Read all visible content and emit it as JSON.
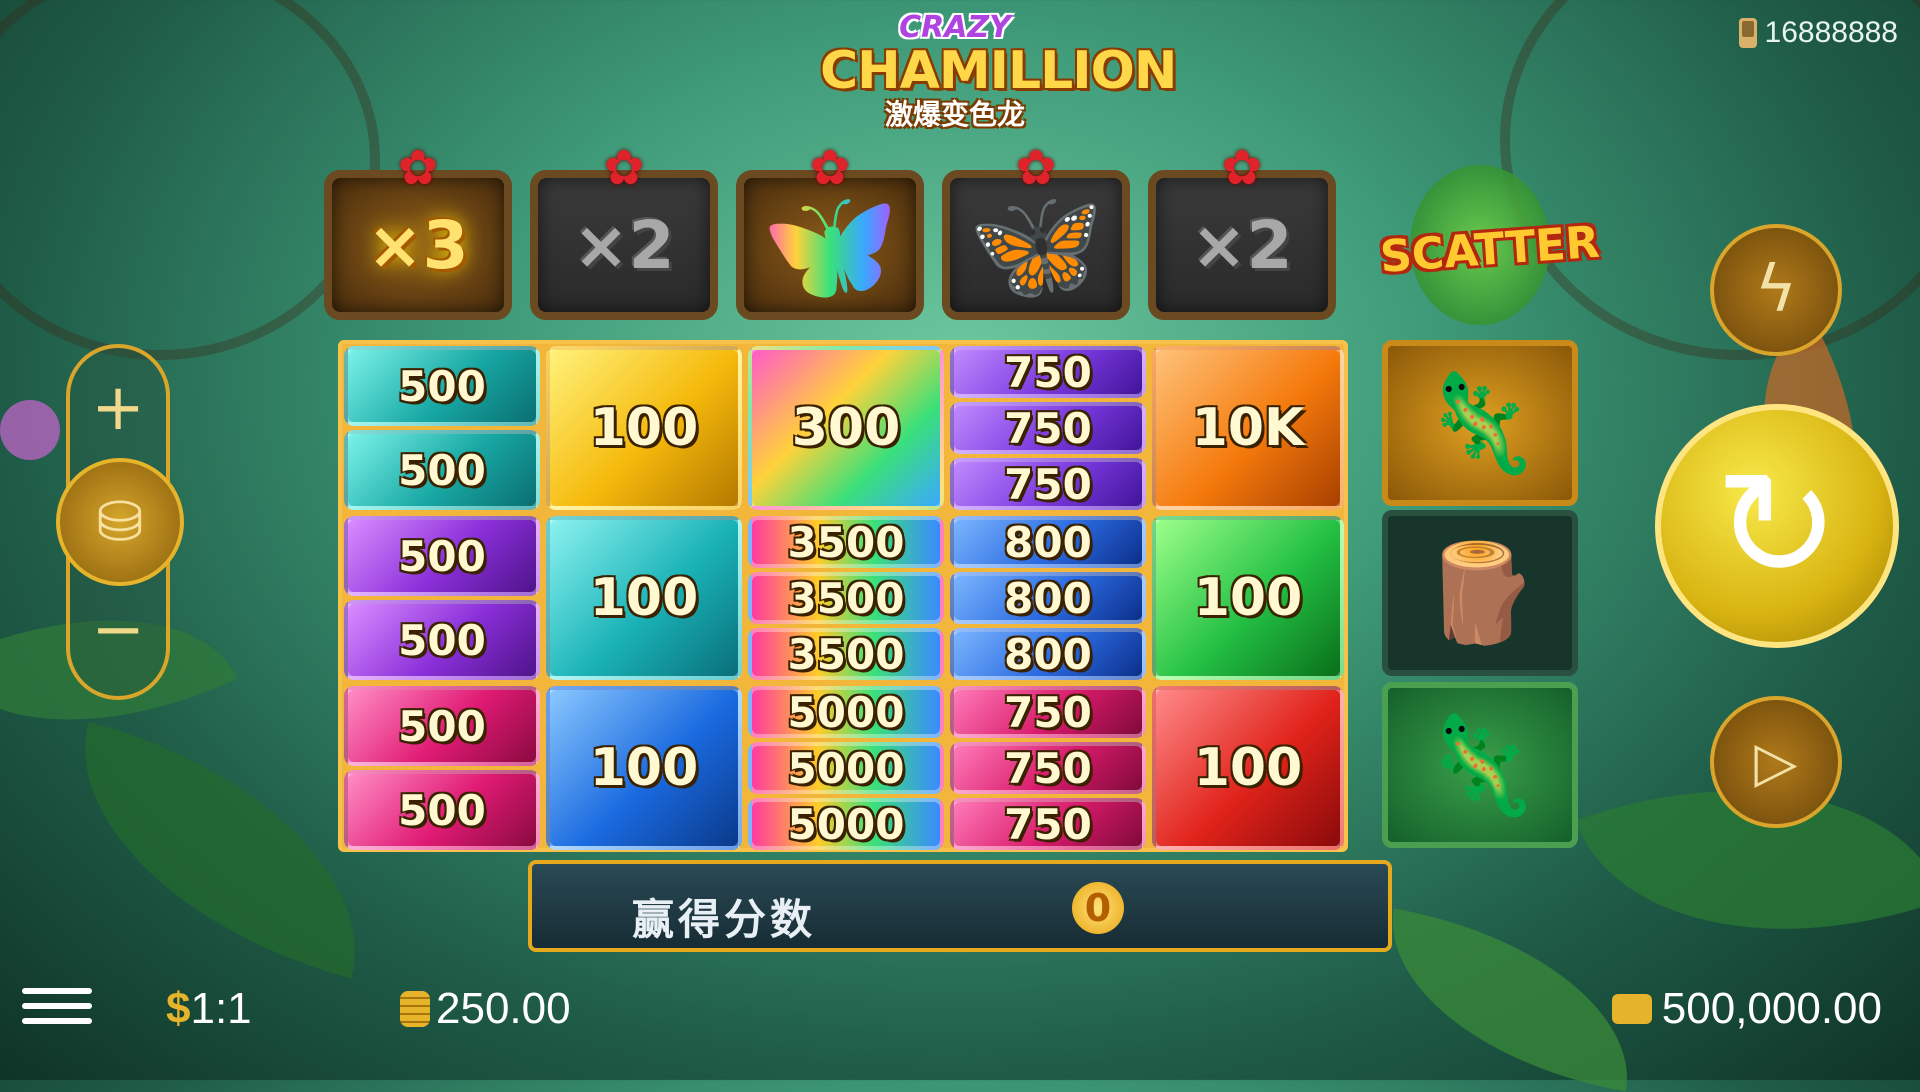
{
  "logo": {
    "line1": "CRAZY",
    "line2": "CHAMILLION",
    "line3": "激爆变色龙"
  },
  "top_balance": "16888888",
  "multipliers": [
    {
      "type": "text",
      "label": "×3",
      "active": true
    },
    {
      "type": "text",
      "label": "×2",
      "active": false
    },
    {
      "type": "butterfly",
      "label": "",
      "active": true
    },
    {
      "type": "butterfly",
      "label": "",
      "active": false
    },
    {
      "type": "text",
      "label": "×2",
      "active": false
    }
  ],
  "scatter_label": "SCATTER",
  "grid": {
    "col1": [
      "500",
      "500",
      "500",
      "500",
      "500",
      "500"
    ],
    "col2": [
      "100",
      "100",
      "100"
    ],
    "col3_top": "300",
    "col3": [
      "3500",
      "3500",
      "3500",
      "5000",
      "5000",
      "5000"
    ],
    "col4": [
      "750",
      "750",
      "750",
      "800",
      "800",
      "800",
      "750",
      "750",
      "750"
    ],
    "col5": [
      "10K",
      "100",
      "100"
    ]
  },
  "symbols": [
    "golden-chameleon",
    "log",
    "green-chameleon"
  ],
  "win": {
    "label": "赢得分数",
    "value": "0"
  },
  "bottom": {
    "ratio_symbol": "$",
    "ratio": "1:1",
    "bet": "250.00",
    "credit": "500,000.00"
  },
  "colors": {
    "accent": "#e6b42b",
    "spin": "#d8b412"
  }
}
